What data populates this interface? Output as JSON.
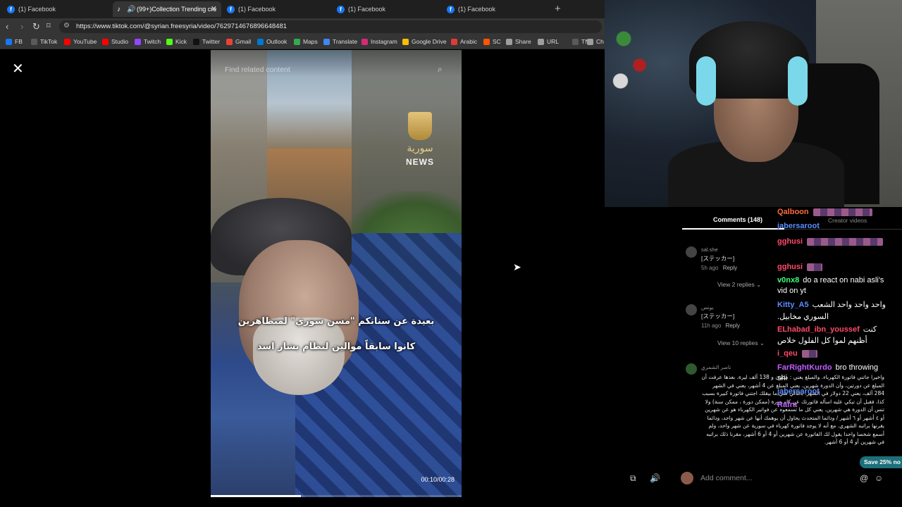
{
  "browser": {
    "tabs": [
      {
        "label": "(1) Facebook",
        "icon": "facebook-icon"
      },
      {
        "label": "(99+)Collection Trending cre",
        "icon": "tiktok-icon",
        "active": true
      },
      {
        "label": "(1) Facebook",
        "icon": "facebook-icon"
      },
      {
        "label": "(1) Facebook",
        "icon": "facebook-icon"
      },
      {
        "label": "(1) Facebook",
        "icon": "facebook-icon"
      }
    ],
    "new_tab": "+",
    "url": "https://www.tiktok.com/@syrian.freesyria/video/7629714676896648481",
    "bookmarks": [
      {
        "label": "FB",
        "color": "#1877f2"
      },
      {
        "label": "TikTok",
        "color": "#5a5a5a"
      },
      {
        "label": "YouTube",
        "color": "#ff0000"
      },
      {
        "label": "Studio",
        "color": "#ff0000"
      },
      {
        "label": "Twitch",
        "color": "#9146ff"
      },
      {
        "label": "Kick",
        "color": "#53fc18"
      },
      {
        "label": "Twitter",
        "color": "#111111"
      },
      {
        "label": "Gmail",
        "color": "#ea4335"
      },
      {
        "label": "Outlook",
        "color": "#0078d4"
      },
      {
        "label": "Maps",
        "color": "#34a853"
      },
      {
        "label": "Translate",
        "color": "#4285f4"
      },
      {
        "label": "Instagram",
        "color": "#d62976"
      },
      {
        "label": "Google Drive",
        "color": "#fbbc04"
      },
      {
        "label": "Arabic",
        "color": "#e53935"
      },
      {
        "label": "SC",
        "color": "#ff5500"
      },
      {
        "label": "Share",
        "color": "#9e9e9e"
      },
      {
        "label": "URL",
        "color": "#9e9e9e"
      },
      {
        "label": "TN",
        "color": "#5a5a5a"
      },
      {
        "label": "Ch",
        "color": "#9e9e9e"
      }
    ]
  },
  "video": {
    "search_placeholder": "Find related content",
    "logo_arabic": "سورية",
    "logo_news": "NEWS",
    "subtitle_line1": "بعيدة عن سنانكم \"مسن سوري\" لمتظاهرين",
    "subtitle_line2": "كانوا سابقاً موالين لنظام بشار اسد",
    "time": "00:10/00:28",
    "progress": 0.36
  },
  "comments": {
    "title": "Comments (148)",
    "creator_tab": "Creator videos",
    "items": [
      {
        "user": "sal.she",
        "text": "[ステッカー]",
        "age": "5h ago",
        "reply": "Reply",
        "replies": "View 2 replies"
      },
      {
        "user": "يونس",
        "text": "[ステッカー]",
        "age": "11h ago",
        "reply": "Reply",
        "replies": "View 10 replies"
      }
    ],
    "long_user": "ناصر الشمري",
    "long_text": "واخيرا جاتني فاتورة الكهرباء. والمبلغ يعني : مليون و 138 ألف ليرة. بعدها عرفت أن المبلغ عن دورتين، وأن الدورة شهرين. يعني المبلغ عن 4 أشهر، يعني في الشهر 284 ألف، يعني 22 دولار في الشهر. بالتالي شي ما بيقلك اجتني فاتورة كبيرة بسبب كذا، فقبل أن تبكي عليه اسأله فاتورتك عن كام دورة (ممكن دورة ، ممكن سنة) ولا تنس أن الدورة هي شهرين. يعني كل ما تسمعوه عن فواتير الكهرباء هو عن شهرين أو ٤ أشهر أو ٦ أشهر / ودائما المتحدث يحاول أن يوهمك أنها عن شهر واحد، ودائما يقرنها براتبه الشهري. مع أنه لا يوجد فاتورة كهرباء في سورية عن شهر واحد، ولم أسمع شخصا واحدا يقول لك الفاتورة عن شهرين أو 4 أو 6 أشهر، مقرنا ذلك براتبه في شهرين أو 4 أو 6 أشهر.",
    "add_placeholder": "Add comment...",
    "save_banner": "Save 25% no"
  },
  "chat": [
    {
      "user": "Qalboon",
      "color": "#ff6a3c",
      "msg": "",
      "emote": 84
    },
    {
      "user": "jabersaroot",
      "color": "#5b8dff",
      "msg": ""
    },
    {
      "user": "gghusi",
      "color": "#ff4a6a",
      "msg": "",
      "emote": 108
    },
    {
      "user": "gghusi",
      "color": "#ff4a6a",
      "msg": "",
      "emote": 22
    },
    {
      "user": "v0nx8",
      "color": "#3cff7a",
      "msg": "do a react on nabi asli's"
    },
    {
      "user": "",
      "color": "#ffffff",
      "msg": "vid on yt"
    },
    {
      "user": "Kitty_A5",
      "color": "#5b8dff",
      "msg": "واحد واحد واحد الشعب"
    },
    {
      "user": "",
      "color": "#ffffff",
      "msg": ".السوري مخابيل"
    },
    {
      "user": "ELhabad_ibn_youssef",
      "color": "#ff4a6a",
      "msg": "كنت"
    },
    {
      "user": "",
      "color": "#ffffff",
      "msg": "أظنهم لموا كل الفلول خلاص"
    },
    {
      "user": "i_qeu",
      "color": "#ff4a6a",
      "msg": "",
      "emote": 22
    },
    {
      "user": "FarRightKurdo",
      "color": "#c060ff",
      "msg": "bro throwing"
    },
    {
      "user": "",
      "color": "#ffffff",
      "msg": "shi"
    },
    {
      "user": "jabersaroot",
      "color": "#5b8dff",
      "msg": ""
    },
    {
      "user": "Rafra",
      "color": "#c060ff",
      "msg": ""
    }
  ]
}
